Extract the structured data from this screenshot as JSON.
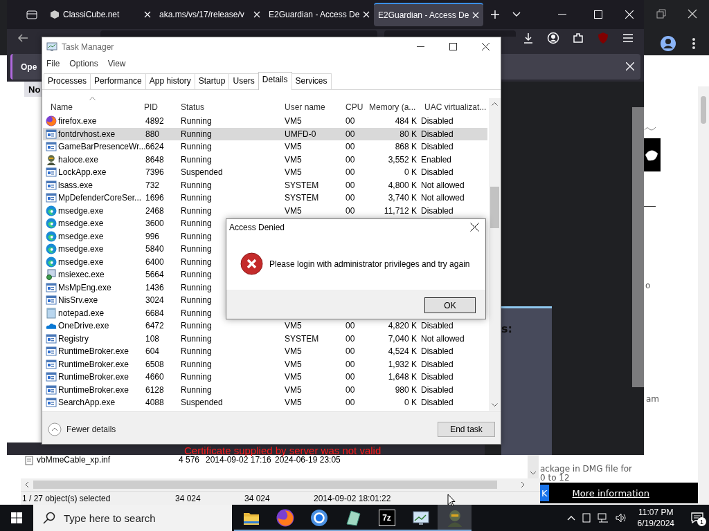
{
  "background_browser": {
    "fragments": [
      "o",
      "am",
      "ackage in DMG file for",
      "0 to 12"
    ],
    "banner": {
      "button": "K",
      "link": "More information"
    }
  },
  "browser": {
    "tabs": [
      {
        "label": "ClassiCube.net",
        "favicon": true,
        "selected": false
      },
      {
        "label": "aka.ms/vs/17/release/v",
        "favicon": false,
        "selected": false
      },
      {
        "label": "E2Guardian - Access De",
        "favicon": false,
        "selected": false
      },
      {
        "label": "E2Guardian - Access De",
        "favicon": false,
        "selected": true
      }
    ],
    "notification": {
      "text": "Ope",
      "button": "No"
    },
    "panel_text": "s:",
    "overlay_message": "Certificate supplied by server was not valid"
  },
  "explorer": {
    "rows": [
      {
        "name": "vbMmeCable_xp.inf",
        "size": "4 576",
        "modified": "2014-09-02 17:16",
        "created": "2024-06-19 23:05"
      }
    ],
    "status": [
      "1 / 27 object(s) selected",
      "34 024",
      "34 024",
      "2014-09-02 18:01:22"
    ]
  },
  "task_manager": {
    "title": "Task Manager",
    "menu": [
      "File",
      "Options",
      "View"
    ],
    "tabs": [
      {
        "label": "Processes",
        "selected": false
      },
      {
        "label": "Performance",
        "selected": false
      },
      {
        "label": "App history",
        "selected": false
      },
      {
        "label": "Startup",
        "selected": false
      },
      {
        "label": "Users",
        "selected": false
      },
      {
        "label": "Details",
        "selected": true
      },
      {
        "label": "Services",
        "selected": false
      }
    ],
    "columns": [
      "Name",
      "PID",
      "Status",
      "User name",
      "CPU",
      "Memory (a...",
      "UAC virtualizat..."
    ],
    "rows": [
      {
        "kind": "firefox",
        "name": "firefox.exe",
        "pid": "4892",
        "status": "Running",
        "user": "VM5",
        "cpu": "00",
        "memory": "484 K",
        "uac": "Disabled",
        "selected": false
      },
      {
        "kind": "window",
        "name": "fontdrvhost.exe",
        "pid": "880",
        "status": "Running",
        "user": "UMFD-0",
        "cpu": "00",
        "memory": "80 K",
        "uac": "Disabled",
        "selected": true
      },
      {
        "kind": "window",
        "name": "GameBarPresenceWr...",
        "pid": "6624",
        "status": "Running",
        "user": "VM5",
        "cpu": "00",
        "memory": "868 K",
        "uac": "Disabled",
        "selected": false
      },
      {
        "kind": "figure",
        "name": "haloce.exe",
        "pid": "8648",
        "status": "Running",
        "user": "VM5",
        "cpu": "00",
        "memory": "3,552 K",
        "uac": "Enabled",
        "selected": false
      },
      {
        "kind": "window",
        "name": "LockApp.exe",
        "pid": "7396",
        "status": "Suspended",
        "user": "VM5",
        "cpu": "00",
        "memory": "0 K",
        "uac": "Disabled",
        "selected": false
      },
      {
        "kind": "window",
        "name": "lsass.exe",
        "pid": "732",
        "status": "Running",
        "user": "SYSTEM",
        "cpu": "00",
        "memory": "4,800 K",
        "uac": "Not allowed",
        "selected": false
      },
      {
        "kind": "window",
        "name": "MpDefenderCoreSer...",
        "pid": "1696",
        "status": "Running",
        "user": "SYSTEM",
        "cpu": "00",
        "memory": "3,740 K",
        "uac": "Not allowed",
        "selected": false
      },
      {
        "kind": "edge",
        "name": "msedge.exe",
        "pid": "2468",
        "status": "Running",
        "user": "VM5",
        "cpu": "00",
        "memory": "11,712 K",
        "uac": "Disabled",
        "selected": false
      },
      {
        "kind": "edge",
        "name": "msedge.exe",
        "pid": "3600",
        "status": "Running",
        "selected": false
      },
      {
        "kind": "edge",
        "name": "msedge.exe",
        "pid": "996",
        "status": "Running",
        "selected": false
      },
      {
        "kind": "edge",
        "name": "msedge.exe",
        "pid": "5840",
        "status": "Running",
        "selected": false
      },
      {
        "kind": "edge",
        "name": "msedge.exe",
        "pid": "6400",
        "status": "Running",
        "selected": false
      },
      {
        "kind": "installer",
        "name": "msiexec.exe",
        "pid": "5664",
        "status": "Running",
        "selected": false
      },
      {
        "kind": "window",
        "name": "MsMpEng.exe",
        "pid": "1436",
        "status": "Running",
        "selected": false
      },
      {
        "kind": "window",
        "name": "NisSrv.exe",
        "pid": "3024",
        "status": "Running",
        "selected": false
      },
      {
        "kind": "notepad",
        "name": "notepad.exe",
        "pid": "6684",
        "status": "Running",
        "selected": false
      },
      {
        "kind": "cloud",
        "name": "OneDrive.exe",
        "pid": "6472",
        "status": "Running",
        "user": "VM5",
        "cpu": "00",
        "memory": "4,820 K",
        "uac": "Disabled",
        "selected": false
      },
      {
        "kind": "window",
        "name": "Registry",
        "pid": "108",
        "status": "Running",
        "user": "SYSTEM",
        "cpu": "00",
        "memory": "7,040 K",
        "uac": "Not allowed",
        "selected": false
      },
      {
        "kind": "window",
        "name": "RuntimeBroker.exe",
        "pid": "604",
        "status": "Running",
        "user": "VM5",
        "cpu": "00",
        "memory": "4,524 K",
        "uac": "Disabled",
        "selected": false
      },
      {
        "kind": "window",
        "name": "RuntimeBroker.exe",
        "pid": "6508",
        "status": "Running",
        "user": "VM5",
        "cpu": "00",
        "memory": "1,932 K",
        "uac": "Disabled",
        "selected": false
      },
      {
        "kind": "window",
        "name": "RuntimeBroker.exe",
        "pid": "4660",
        "status": "Running",
        "user": "VM5",
        "cpu": "00",
        "memory": "1,648 K",
        "uac": "Disabled",
        "selected": false
      },
      {
        "kind": "window",
        "name": "RuntimeBroker.exe",
        "pid": "6128",
        "status": "Running",
        "user": "VM5",
        "cpu": "00",
        "memory": "980 K",
        "uac": "Disabled",
        "selected": false
      },
      {
        "kind": "window",
        "name": "SearchApp.exe",
        "pid": "4088",
        "status": "Suspended",
        "user": "VM5",
        "cpu": "00",
        "memory": "0 K",
        "uac": "Disabled",
        "selected": false
      }
    ],
    "footer": {
      "toggle": "Fewer details",
      "button": "End task"
    }
  },
  "dialog": {
    "title": "Access Denied",
    "message": "Please login with administrator privileges and try again",
    "button": "OK"
  },
  "taskbar": {
    "search_placeholder": "Type here to search",
    "apps": [
      {
        "kind": "folder",
        "active": false
      },
      {
        "kind": "firefox",
        "active": false
      },
      {
        "kind": "chrome",
        "active": false
      },
      {
        "kind": "tile",
        "active": false
      },
      {
        "kind": "archiver",
        "label": "7z",
        "active": false
      },
      {
        "kind": "monitor",
        "active": false
      },
      {
        "kind": "figure",
        "active": true
      }
    ],
    "time": "11:07 PM",
    "date": "6/19/2024",
    "notifications": "1"
  }
}
